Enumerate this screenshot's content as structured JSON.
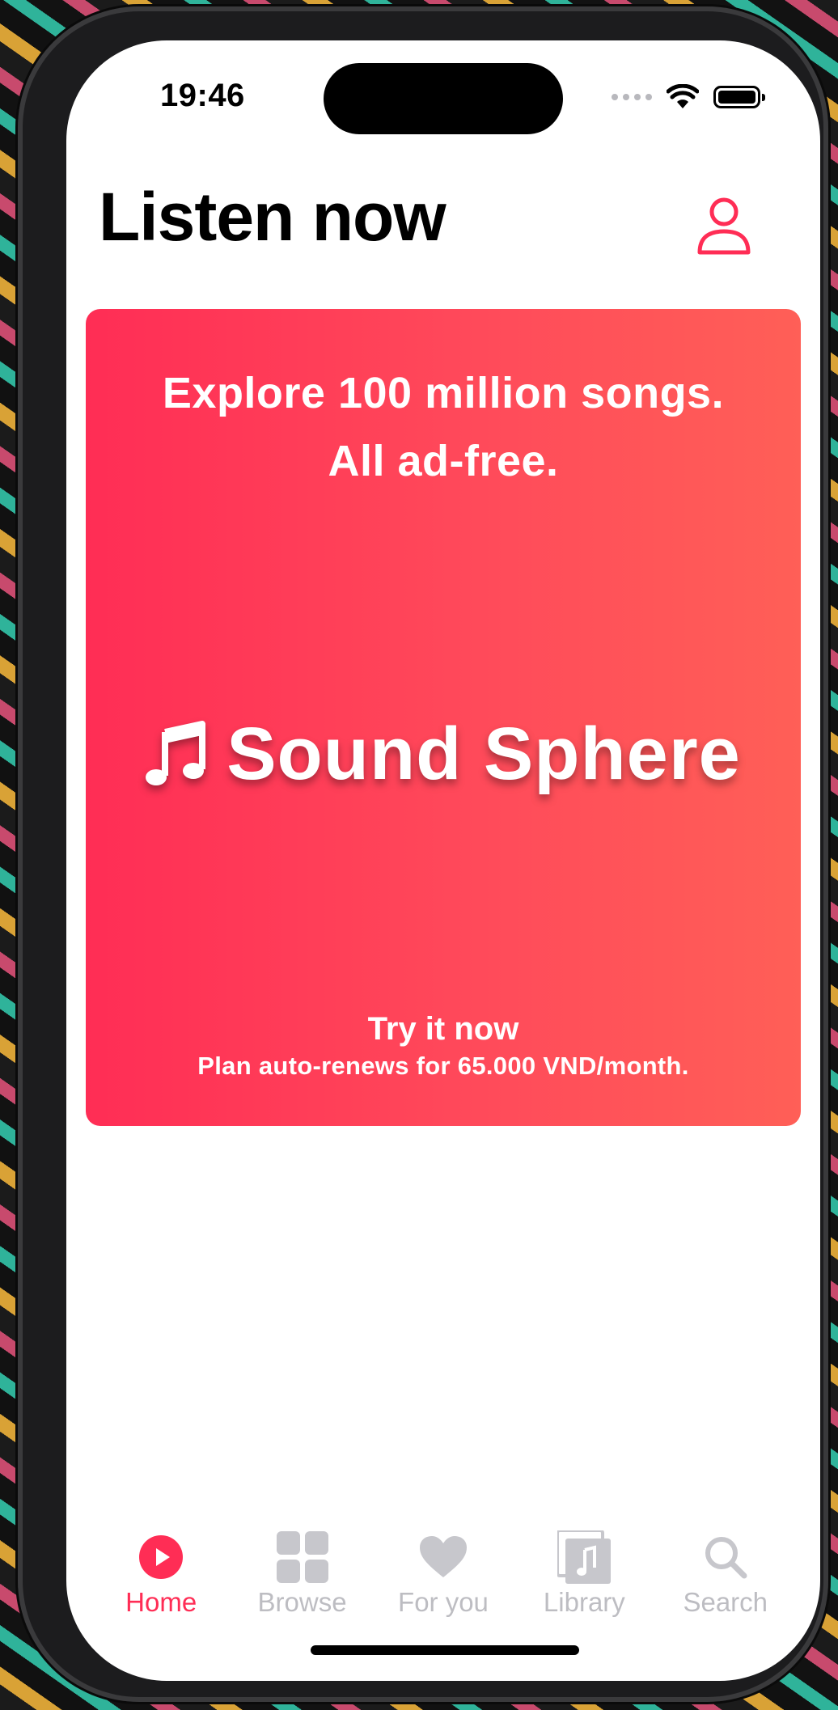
{
  "status_bar": {
    "time": "19:46",
    "signal_icon": "signal-dots-icon",
    "wifi_icon": "wifi-icon",
    "battery_icon": "battery-icon"
  },
  "header": {
    "title": "Listen now",
    "profile_icon": "person-icon"
  },
  "promo": {
    "headline_line1": "Explore 100 million songs.",
    "headline_line2": "All ad-free.",
    "brand_icon": "music-note-icon",
    "brand_name": "Sound Sphere",
    "cta": "Try it now",
    "subtext": "Plan auto-renews for 65.000 VND/month.",
    "gradient_start": "#ff2d55",
    "gradient_end": "#ff5f57"
  },
  "tab_bar": {
    "items": [
      {
        "label": "Home",
        "icon": "play-circle-icon",
        "active": true
      },
      {
        "label": "Browse",
        "icon": "grid-icon",
        "active": false
      },
      {
        "label": "For you",
        "icon": "heart-icon",
        "active": false
      },
      {
        "label": "Library",
        "icon": "music-library-icon",
        "active": false
      },
      {
        "label": "Search",
        "icon": "search-icon",
        "active": false
      }
    ]
  },
  "colors": {
    "accent": "#ff2d55",
    "inactive": "#bdbdc2"
  }
}
